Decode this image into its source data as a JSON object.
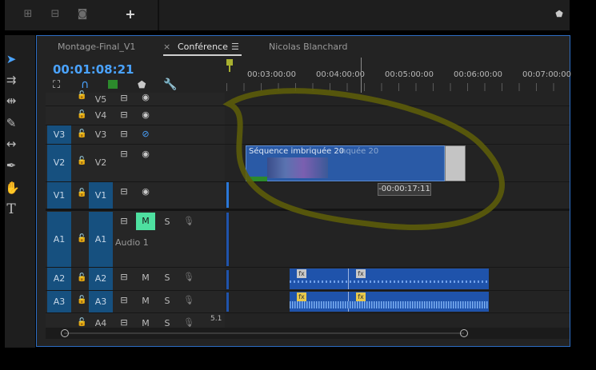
{
  "panel": {
    "tabs": [
      "Montage-Final_V1",
      "Conférence",
      "Nicolas Blanchard"
    ],
    "active_tab_close": "×",
    "active_tab_menu": "☰",
    "timecode": "00:01:08:21"
  },
  "ruler": {
    "labels": [
      "00:03:00:00",
      "00:04:00:00",
      "00:05:00:00",
      "00:06:00:00",
      "00:07:00:00"
    ]
  },
  "tracks": {
    "video": [
      {
        "source": "",
        "target": "V5"
      },
      {
        "source": "",
        "target": "V4"
      },
      {
        "source": "V3",
        "target": "V3"
      },
      {
        "source": "V2",
        "target": "V2"
      },
      {
        "source": "V1",
        "target": "V1"
      }
    ],
    "audio": [
      {
        "source": "A1",
        "target": "A1",
        "name": "Audio 1",
        "mute": "M",
        "solo": "S"
      },
      {
        "source": "A2",
        "target": "A2",
        "mute": "M",
        "solo": "S"
      },
      {
        "source": "A3",
        "target": "A3",
        "mute": "M",
        "solo": "S"
      },
      {
        "source": "",
        "target": "A4",
        "mute": "M",
        "solo": "S"
      }
    ],
    "audio_channel_label": "5.1"
  },
  "clips": {
    "nested_sequence": "Séquence imbriquée 20",
    "ghost_label": "nquée 20",
    "drag_offset": "-00:00:17:11",
    "fx_badge": "fx"
  },
  "colors": {
    "accent": "#4aa3ff",
    "clip": "#27569e",
    "audio_clip": "#1f53ab",
    "mute_on": "#4ee0a0",
    "annotation": "#5c5c0a"
  }
}
